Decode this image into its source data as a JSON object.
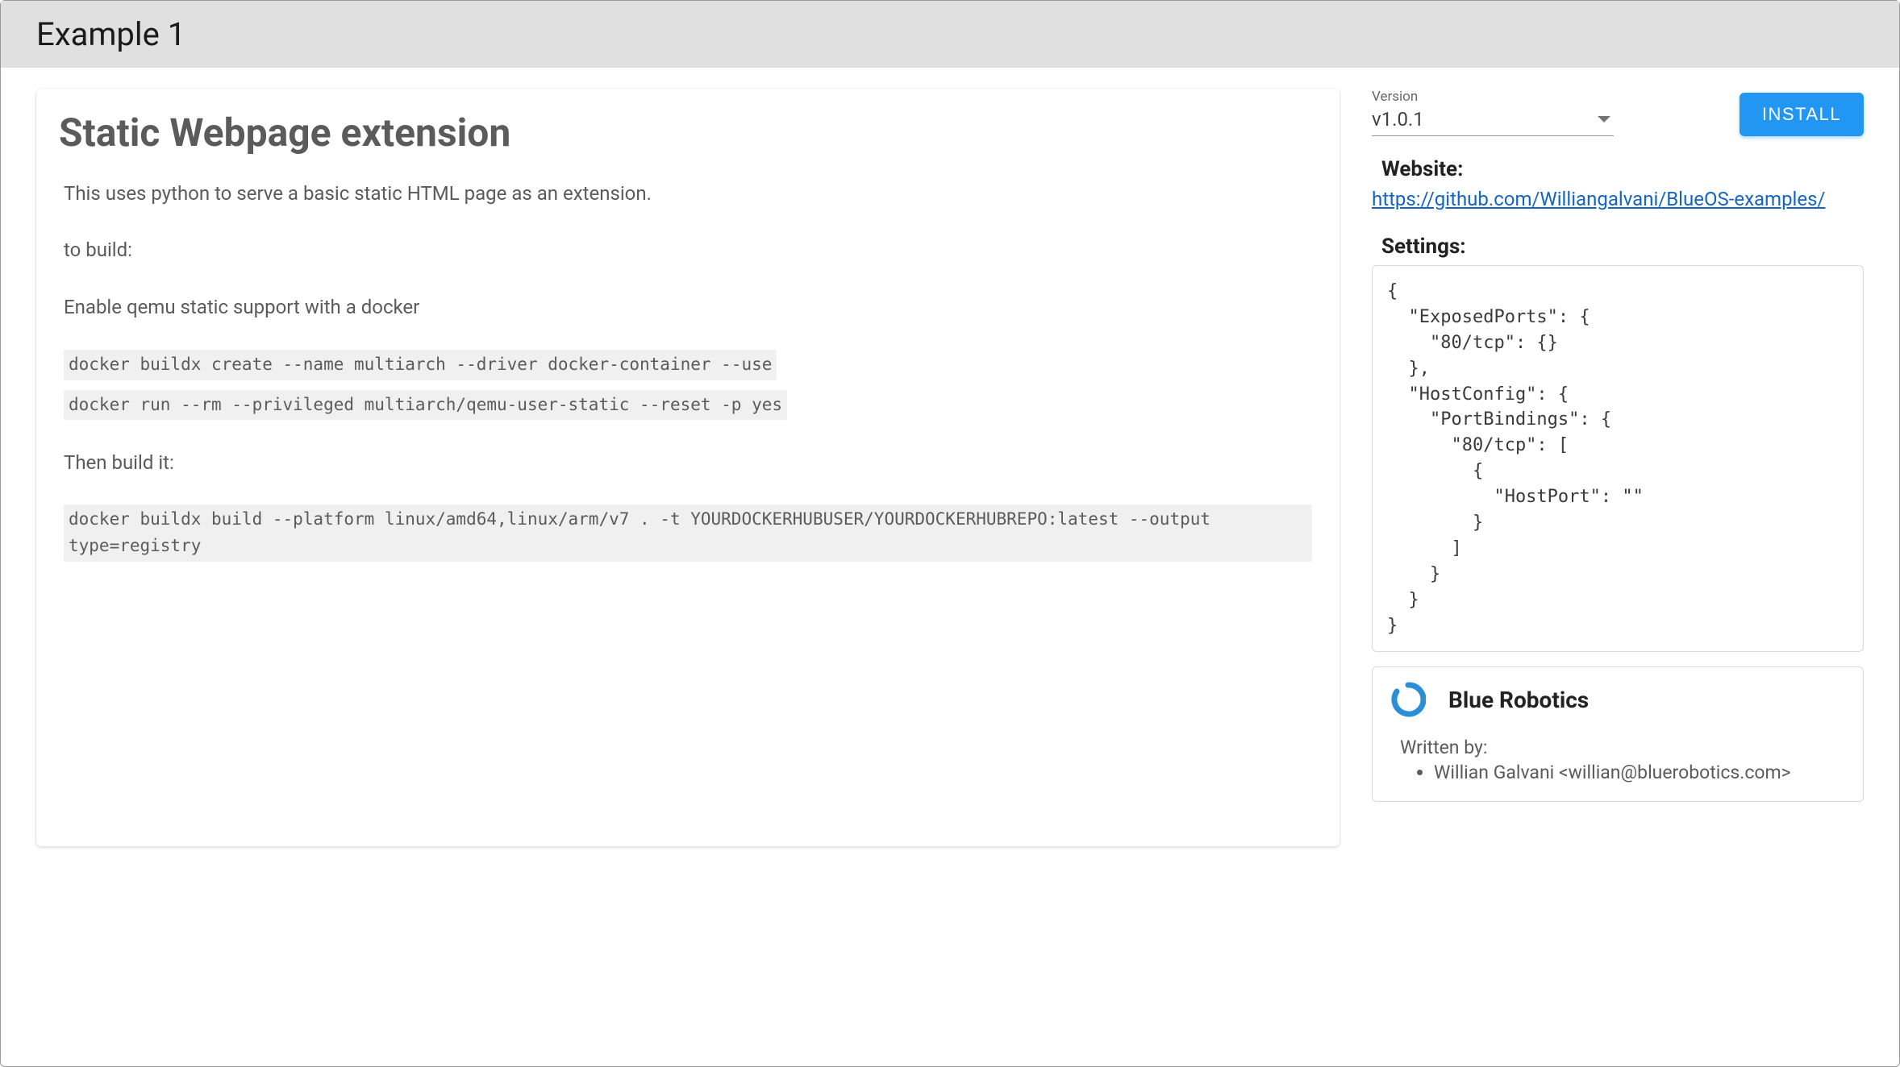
{
  "header": {
    "title": "Example 1"
  },
  "main": {
    "card_title": "Static Webpage extension",
    "intro": "This uses python to serve a basic static HTML page as an extension.",
    "build_label": "to build:",
    "enable_qemu": "Enable qemu static support with a docker",
    "code1": "docker buildx create --name multiarch --driver docker-container --use",
    "code2": "docker run --rm --privileged multiarch/qemu-user-static --reset -p yes",
    "then_build": "Then build it:",
    "code3": "docker buildx build --platform linux/amd64,linux/arm/v7 . -t YOURDOCKERHUBUSER/YOURDOCKERHUBREPO:latest --output type=registry"
  },
  "sidebar": {
    "version_label": "Version",
    "version_value": "v1.0.1",
    "install_label": "INSTALL",
    "website_heading": "Website:",
    "website_url": "https://github.com/Williangalvani/BlueOS-examples/",
    "settings_heading": "Settings:",
    "settings_json": "{\n  \"ExposedPorts\": {\n    \"80/tcp\": {}\n  },\n  \"HostConfig\": {\n    \"PortBindings\": {\n      \"80/tcp\": [\n        {\n          \"HostPort\": \"\"\n        }\n      ]\n    }\n  }\n}",
    "company_name": "Blue Robotics",
    "written_by_label": "Written by:",
    "authors": [
      "Willian Galvani <willian@bluerobotics.com>"
    ]
  }
}
